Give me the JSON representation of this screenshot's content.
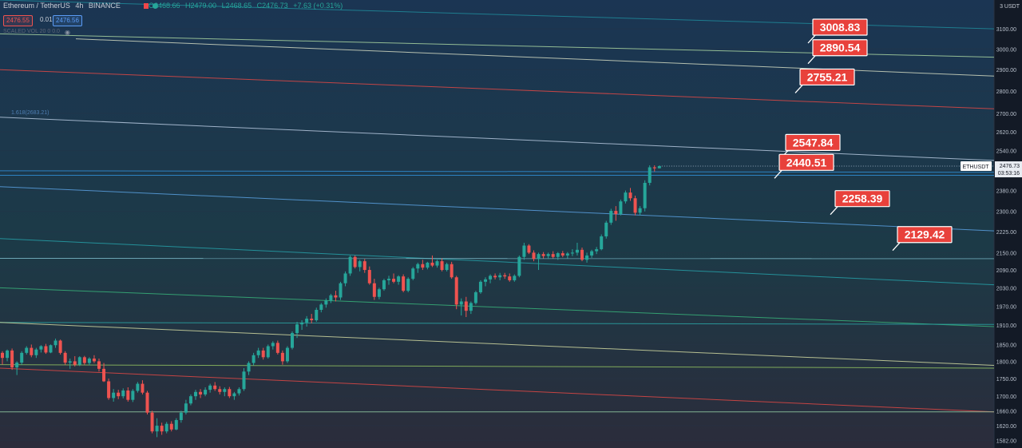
{
  "header": {
    "symbol": "Ethereum / TetherUS",
    "interval": "4h",
    "exchange": "BINANCE",
    "open": "O2468.66",
    "high": "H2479.00",
    "low": "L2468.65",
    "close": "C2476.73",
    "change": "+7.63 (+0.31%)",
    "bid": "2476.55",
    "spread": "0.01",
    "ask": "2476.56",
    "indicator_text": "SCALED VOL 20 0 0.0"
  },
  "fib_label": "1.618(2683.21)",
  "axis_unit": "USDT",
  "current_price": {
    "ticker": "ETHUSDT",
    "price": "2476.73",
    "price_value": 2476.73,
    "countdown": "03:53:16"
  },
  "colors": {
    "background": "#1d2738",
    "bullish": "#26a69a",
    "bearish": "#ef5350",
    "label_bg": "#e8413b"
  },
  "chart_data": {
    "type": "candlestick",
    "y_scale": "log",
    "ylim": [
      1562,
      3250
    ],
    "y_ticks": [
      3100.0,
      3000.0,
      2900.0,
      2800.0,
      2700.0,
      2620.0,
      2540.0,
      2460.0,
      2380.0,
      2300.0,
      2225.0,
      2150.0,
      2090.0,
      2030.0,
      1970.0,
      1910.0,
      1850.0,
      1800.0,
      1750.0,
      1700.0,
      1660.0,
      1620.0,
      1582.0
    ],
    "level_labels": [
      {
        "text": "3008.83",
        "value": 3008.83
      },
      {
        "text": "2890.54",
        "value": 2890.54
      },
      {
        "text": "2755.21",
        "value": 2755.21
      },
      {
        "text": "2547.84",
        "value": 2547.84
      },
      {
        "text": "2440.51",
        "value": 2440.51
      },
      {
        "text": "2258.39",
        "value": 2258.39
      },
      {
        "text": "2129.42",
        "value": 2129.42
      }
    ],
    "candles": [
      [
        1825,
        1830,
        1790,
        1810
      ],
      [
        1810,
        1835,
        1800,
        1832
      ],
      [
        1832,
        1838,
        1775,
        1782
      ],
      [
        1782,
        1800,
        1760,
        1796
      ],
      [
        1796,
        1830,
        1790,
        1825
      ],
      [
        1825,
        1845,
        1820,
        1840
      ],
      [
        1840,
        1850,
        1812,
        1818
      ],
      [
        1818,
        1840,
        1810,
        1835
      ],
      [
        1835,
        1848,
        1826,
        1845
      ],
      [
        1845,
        1852,
        1822,
        1826
      ],
      [
        1826,
        1850,
        1824,
        1848
      ],
      [
        1848,
        1868,
        1840,
        1862
      ],
      [
        1862,
        1865,
        1820,
        1825
      ],
      [
        1825,
        1830,
        1790,
        1796
      ],
      [
        1796,
        1808,
        1778,
        1800
      ],
      [
        1800,
        1815,
        1785,
        1790
      ],
      [
        1790,
        1815,
        1786,
        1812
      ],
      [
        1812,
        1816,
        1790,
        1795
      ],
      [
        1795,
        1812,
        1788,
        1808
      ],
      [
        1808,
        1818,
        1795,
        1800
      ],
      [
        1800,
        1808,
        1770,
        1778
      ],
      [
        1778,
        1795,
        1740,
        1742
      ],
      [
        1742,
        1750,
        1690,
        1695
      ],
      [
        1695,
        1720,
        1685,
        1710
      ],
      [
        1710,
        1718,
        1692,
        1700
      ],
      [
        1700,
        1722,
        1694,
        1716
      ],
      [
        1716,
        1725,
        1685,
        1690
      ],
      [
        1690,
        1720,
        1684,
        1715
      ],
      [
        1715,
        1740,
        1710,
        1735
      ],
      [
        1735,
        1745,
        1705,
        1710
      ],
      [
        1710,
        1715,
        1650,
        1655
      ],
      [
        1655,
        1660,
        1600,
        1605
      ],
      [
        1605,
        1640,
        1590,
        1620
      ],
      [
        1620,
        1628,
        1596,
        1605
      ],
      [
        1605,
        1630,
        1600,
        1625
      ],
      [
        1625,
        1632,
        1605,
        1610
      ],
      [
        1610,
        1640,
        1608,
        1635
      ],
      [
        1635,
        1660,
        1628,
        1655
      ],
      [
        1655,
        1690,
        1650,
        1680
      ],
      [
        1680,
        1705,
        1675,
        1700
      ],
      [
        1700,
        1718,
        1690,
        1712
      ],
      [
        1712,
        1720,
        1695,
        1705
      ],
      [
        1705,
        1725,
        1700,
        1718
      ],
      [
        1718,
        1735,
        1710,
        1730
      ],
      [
        1730,
        1740,
        1715,
        1720
      ],
      [
        1720,
        1728,
        1705,
        1712
      ],
      [
        1712,
        1725,
        1700,
        1720
      ],
      [
        1720,
        1726,
        1695,
        1700
      ],
      [
        1700,
        1712,
        1690,
        1708
      ],
      [
        1708,
        1725,
        1702,
        1720
      ],
      [
        1720,
        1780,
        1715,
        1770
      ],
      [
        1770,
        1800,
        1760,
        1795
      ],
      [
        1795,
        1825,
        1788,
        1818
      ],
      [
        1818,
        1840,
        1810,
        1832
      ],
      [
        1832,
        1840,
        1805,
        1812
      ],
      [
        1812,
        1850,
        1808,
        1845
      ],
      [
        1845,
        1860,
        1835,
        1855
      ],
      [
        1855,
        1862,
        1820,
        1825
      ],
      [
        1825,
        1832,
        1790,
        1800
      ],
      [
        1800,
        1845,
        1795,
        1840
      ],
      [
        1840,
        1890,
        1835,
        1885
      ],
      [
        1885,
        1920,
        1870,
        1912
      ],
      [
        1912,
        1925,
        1895,
        1918
      ],
      [
        1918,
        1938,
        1905,
        1930
      ],
      [
        1930,
        1945,
        1915,
        1925
      ],
      [
        1925,
        1965,
        1920,
        1958
      ],
      [
        1958,
        1980,
        1950,
        1975
      ],
      [
        1975,
        1995,
        1965,
        1988
      ],
      [
        1988,
        2010,
        1980,
        2005
      ],
      [
        2005,
        2020,
        1985,
        1998
      ],
      [
        1998,
        2050,
        1990,
        2045
      ],
      [
        2045,
        2085,
        2035,
        2078
      ],
      [
        2078,
        2140,
        2070,
        2135
      ],
      [
        2135,
        2140,
        2095,
        2100
      ],
      [
        2100,
        2125,
        2085,
        2120
      ],
      [
        2120,
        2128,
        2080,
        2090
      ],
      [
        2090,
        2102,
        2040,
        2045
      ],
      [
        2045,
        2060,
        1990,
        2000
      ],
      [
        2000,
        2030,
        1992,
        2025
      ],
      [
        2025,
        2060,
        2020,
        2055
      ],
      [
        2055,
        2070,
        2040,
        2060
      ],
      [
        2060,
        2078,
        2045,
        2050
      ],
      [
        2050,
        2072,
        2040,
        2068
      ],
      [
        2068,
        2075,
        2015,
        2020
      ],
      [
        2020,
        2065,
        2015,
        2060
      ],
      [
        2060,
        2100,
        2055,
        2095
      ],
      [
        2095,
        2115,
        2080,
        2110
      ],
      [
        2110,
        2125,
        2090,
        2098
      ],
      [
        2098,
        2118,
        2092,
        2115
      ],
      [
        2115,
        2140,
        2100,
        2105
      ],
      [
        2105,
        2125,
        2098,
        2120
      ],
      [
        2120,
        2130,
        2085,
        2090
      ],
      [
        2090,
        2115,
        2085,
        2110
      ],
      [
        2110,
        2118,
        2060,
        2065
      ],
      [
        2065,
        2070,
        1960,
        1975
      ],
      [
        1975,
        1995,
        1940,
        1985
      ],
      [
        1985,
        2000,
        1935,
        1955
      ],
      [
        1955,
        1985,
        1945,
        1980
      ],
      [
        1980,
        2020,
        1975,
        2015
      ],
      [
        2015,
        2055,
        2010,
        2050
      ],
      [
        2050,
        2065,
        2035,
        2058
      ],
      [
        2058,
        2075,
        2045,
        2070
      ],
      [
        2070,
        2078,
        2058,
        2065
      ],
      [
        2065,
        2080,
        2055,
        2072
      ],
      [
        2072,
        2080,
        2060,
        2068
      ],
      [
        2068,
        2078,
        2050,
        2055
      ],
      [
        2055,
        2075,
        2050,
        2070
      ],
      [
        2070,
        2140,
        2065,
        2135
      ],
      [
        2135,
        2185,
        2125,
        2175
      ],
      [
        2175,
        2180,
        2145,
        2150
      ],
      [
        2150,
        2158,
        2120,
        2128
      ],
      [
        2128,
        2150,
        2090,
        2145
      ],
      [
        2145,
        2152,
        2130,
        2138
      ],
      [
        2138,
        2150,
        2128,
        2145
      ],
      [
        2145,
        2155,
        2130,
        2135
      ],
      [
        2135,
        2152,
        2125,
        2148
      ],
      [
        2148,
        2156,
        2134,
        2140
      ],
      [
        2140,
        2152,
        2130,
        2147
      ],
      [
        2147,
        2162,
        2138,
        2150
      ],
      [
        2150,
        2185,
        2140,
        2160
      ],
      [
        2160,
        2168,
        2120,
        2125
      ],
      [
        2125,
        2150,
        2115,
        2140
      ],
      [
        2140,
        2160,
        2132,
        2155
      ],
      [
        2155,
        2170,
        2145,
        2162
      ],
      [
        2162,
        2215,
        2158,
        2208
      ],
      [
        2208,
        2265,
        2200,
        2258
      ],
      [
        2258,
        2310,
        2250,
        2302
      ],
      [
        2302,
        2320,
        2265,
        2290
      ],
      [
        2290,
        2345,
        2285,
        2338
      ],
      [
        2338,
        2380,
        2330,
        2372
      ],
      [
        2372,
        2390,
        2340,
        2350
      ],
      [
        2350,
        2360,
        2285,
        2295
      ],
      [
        2295,
        2320,
        2285,
        2312
      ],
      [
        2312,
        2420,
        2300,
        2410
      ],
      [
        2410,
        2480,
        2400,
        2472
      ],
      [
        2472,
        2480,
        2455,
        2468
      ],
      [
        2468,
        2479,
        2468,
        2477
      ]
    ],
    "trend_lines": [
      {
        "color": "#1f8a9a",
        "from": [
          0,
          3250
        ],
        "to": [
          1245,
          3100
        ]
      },
      {
        "color": "#a8d4a0",
        "from": [
          0,
          3075
        ],
        "to": [
          1245,
          2960
        ]
      },
      {
        "color": "#d0d8c0",
        "from": [
          95,
          3050
        ],
        "to": [
          1245,
          2870
        ]
      },
      {
        "color": "#e04845",
        "from": [
          0,
          2900
        ],
        "to": [
          1245,
          2720
        ]
      },
      {
        "color": "#b6c8de",
        "from": [
          0,
          2683
        ],
        "to": [
          1245,
          2500
        ]
      },
      {
        "color": "#2f8fd8",
        "from": [
          0,
          2440
        ],
        "to": [
          1245,
          2440
        ]
      },
      {
        "color": "#2f8fd8",
        "from": [
          0,
          2458
        ],
        "to": [
          1245,
          2452
        ]
      },
      {
        "color": "#5aa0e0",
        "from": [
          0,
          2395
        ],
        "to": [
          1245,
          2228
        ]
      },
      {
        "color": "#26a0a8",
        "from": [
          0,
          2200
        ],
        "to": [
          1245,
          2040
        ]
      },
      {
        "color": "#7ab8c8",
        "from": [
          0,
          2130
        ],
        "to": [
          1245,
          2129
        ]
      },
      {
        "color": "#38b27a",
        "from": [
          0,
          2030
        ],
        "to": [
          1245,
          1905
        ]
      },
      {
        "color": "#2aa4a4",
        "from": [
          0,
          1918
        ],
        "to": [
          1245,
          1912
        ]
      },
      {
        "color": "#d0d8a0",
        "from": [
          0,
          1918
        ],
        "to": [
          1245,
          1788
        ]
      },
      {
        "color": "#90c060",
        "from": [
          0,
          1790
        ],
        "to": [
          1245,
          1780
        ]
      },
      {
        "color": "#e04845",
        "from": [
          0,
          1780
        ],
        "to": [
          1245,
          1657
        ]
      },
      {
        "color": "#90c8a0",
        "from": [
          0,
          1657
        ],
        "to": [
          1245,
          1657
        ]
      }
    ]
  }
}
